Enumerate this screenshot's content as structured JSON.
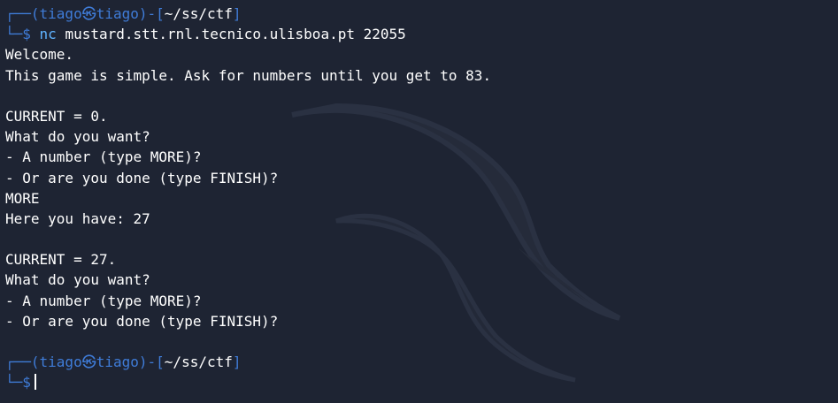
{
  "prompt": {
    "user": "tiago",
    "at_symbol": "㉿",
    "host": "tiago",
    "dir": "~/ss/ctf",
    "sign": "$",
    "top_left": "┌──(",
    "mid": ")-[",
    "end": "]",
    "bottom_left": "└─"
  },
  "session": {
    "command": "nc",
    "command_args": "mustard.stt.rnl.tecnico.ulisboa.pt 22055",
    "output": [
      "Welcome.",
      "This game is simple. Ask for numbers until you get to 83.",
      "",
      "CURRENT = 0.",
      "What do you want?",
      "- A number (type MORE)?",
      "- Or are you done (type FINISH)?",
      "MORE",
      "Here you have: 27",
      "",
      "CURRENT = 27.",
      "What do you want?",
      "- A number (type MORE)?",
      "- Or are you done (type FINISH)?",
      ""
    ]
  },
  "colors": {
    "background": "#1e2433",
    "prompt_blue": "#3f7cd8",
    "command_blue": "#5fb3ff",
    "text": "#ffffff"
  }
}
